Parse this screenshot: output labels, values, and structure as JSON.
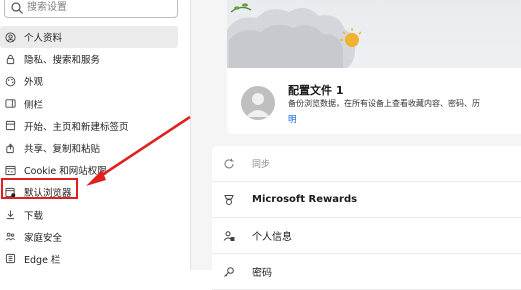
{
  "search": {
    "placeholder": "搜索设置"
  },
  "sidebar": {
    "items": [
      {
        "label": "个人资料",
        "icon": "profile-icon",
        "active": true
      },
      {
        "label": "隐私、搜索和服务",
        "icon": "lock-icon"
      },
      {
        "label": "外观",
        "icon": "appearance-icon"
      },
      {
        "label": "侧栏",
        "icon": "sidebar-icon"
      },
      {
        "label": "开始、主页和新建标签页",
        "icon": "home-icon"
      },
      {
        "label": "共享、复制和粘贴",
        "icon": "share-icon"
      },
      {
        "label": "Cookie 和网站权限",
        "icon": "cookie-icon"
      },
      {
        "label": "默认浏览器",
        "icon": "browser-icon"
      },
      {
        "label": "下载",
        "icon": "download-icon"
      },
      {
        "label": "家庭安全",
        "icon": "family-icon"
      },
      {
        "label": "Edge 栏",
        "icon": "edge-bar-icon"
      }
    ]
  },
  "profile": {
    "name": "配置文件 1",
    "description": "备份浏览数据，在所有设备上查看收藏内容、密码、历",
    "link": "明"
  },
  "settings_rows": [
    {
      "label": "同步",
      "icon": "sync-icon",
      "style": "dim"
    },
    {
      "label": "Microsoft Rewards",
      "icon": "rewards-icon",
      "style": "bold"
    },
    {
      "label": "个人信息",
      "icon": "personal-info-icon",
      "style": "normal"
    },
    {
      "label": "密码",
      "icon": "key-icon",
      "style": "normal"
    }
  ],
  "colors": {
    "highlight": "#e02020",
    "link": "#0a6ed1",
    "active_bg": "#ebebeb"
  }
}
